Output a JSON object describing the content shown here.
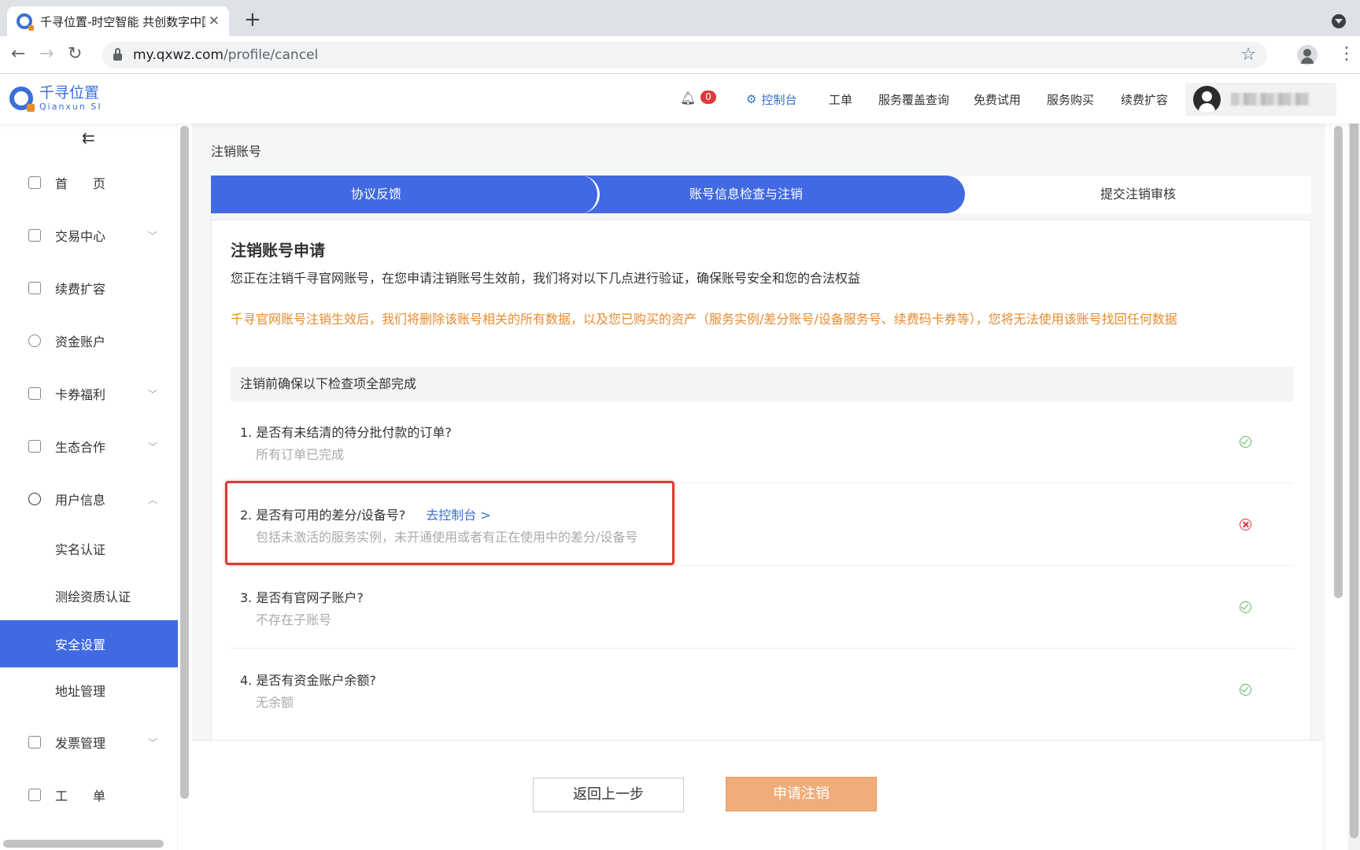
{
  "browser": {
    "tab_title": "千寻位置-时空智能 共创数字中国",
    "url_host": "my.qxwz.com",
    "url_path": "/profile/cancel"
  },
  "header": {
    "logo_cn": "千寻位置",
    "logo_en": "Qianxun SI",
    "notification_count": "0",
    "nav": [
      "控制台",
      "工单",
      "服务覆盖查询",
      "免费试用",
      "服务购买",
      "续费扩容"
    ]
  },
  "sidebar": {
    "items": [
      {
        "label": "首　　页"
      },
      {
        "label": "交易中心"
      },
      {
        "label": "续费扩容"
      },
      {
        "label": "资金账户"
      },
      {
        "label": "卡券福利"
      },
      {
        "label": "生态合作"
      },
      {
        "label": "用户信息"
      }
    ],
    "sub_items": [
      {
        "label": "实名认证"
      },
      {
        "label": "测绘资质认证"
      },
      {
        "label": "安全设置"
      },
      {
        "label": "地址管理"
      }
    ],
    "bottom_items": [
      {
        "label": "发票管理"
      },
      {
        "label": "工　　单"
      }
    ]
  },
  "main": {
    "page_label": "注销账号",
    "steps": [
      "协议反馈",
      "账号信息检查与注销",
      "提交注销审核"
    ],
    "card_title": "注销账号申请",
    "card_desc": "您正在注销千寻官网账号，在您申请注销账号生效前，我们将对以下几点进行验证，确保账号安全和您的合法权益",
    "card_warn": "千寻官网账号注销生效后，我们将删除该账号相关的所有数据，以及您已购买的资产（服务实例/差分账号/设备服务号、续费码卡券等），您将无法使用该账号找回任何数据",
    "check_head": "注销前确保以下检查项全部完成",
    "checks": [
      {
        "q": "1. 是否有未结清的待分批付款的订单?",
        "a": "所有订单已完成",
        "status": "ok"
      },
      {
        "q": "2. 是否有可用的差分/设备号?",
        "link": "去控制台 >",
        "a": "包括未激活的服务实例，未开通使用或者有正在使用中的差分/设备号",
        "status": "bad"
      },
      {
        "q": "3. 是否有官网子账户?",
        "a": "不存在子账号",
        "status": "ok"
      },
      {
        "q": "4. 是否有资金账户余额?",
        "a": "无余额",
        "status": "ok"
      }
    ],
    "back_button": "返回上一步",
    "submit_button": "申请注销"
  },
  "colors": {
    "primary": "#4169e1",
    "warning": "#e78b2d",
    "submit": "#f0ad7a",
    "error": "#d9363e",
    "success": "#5cb85c"
  }
}
